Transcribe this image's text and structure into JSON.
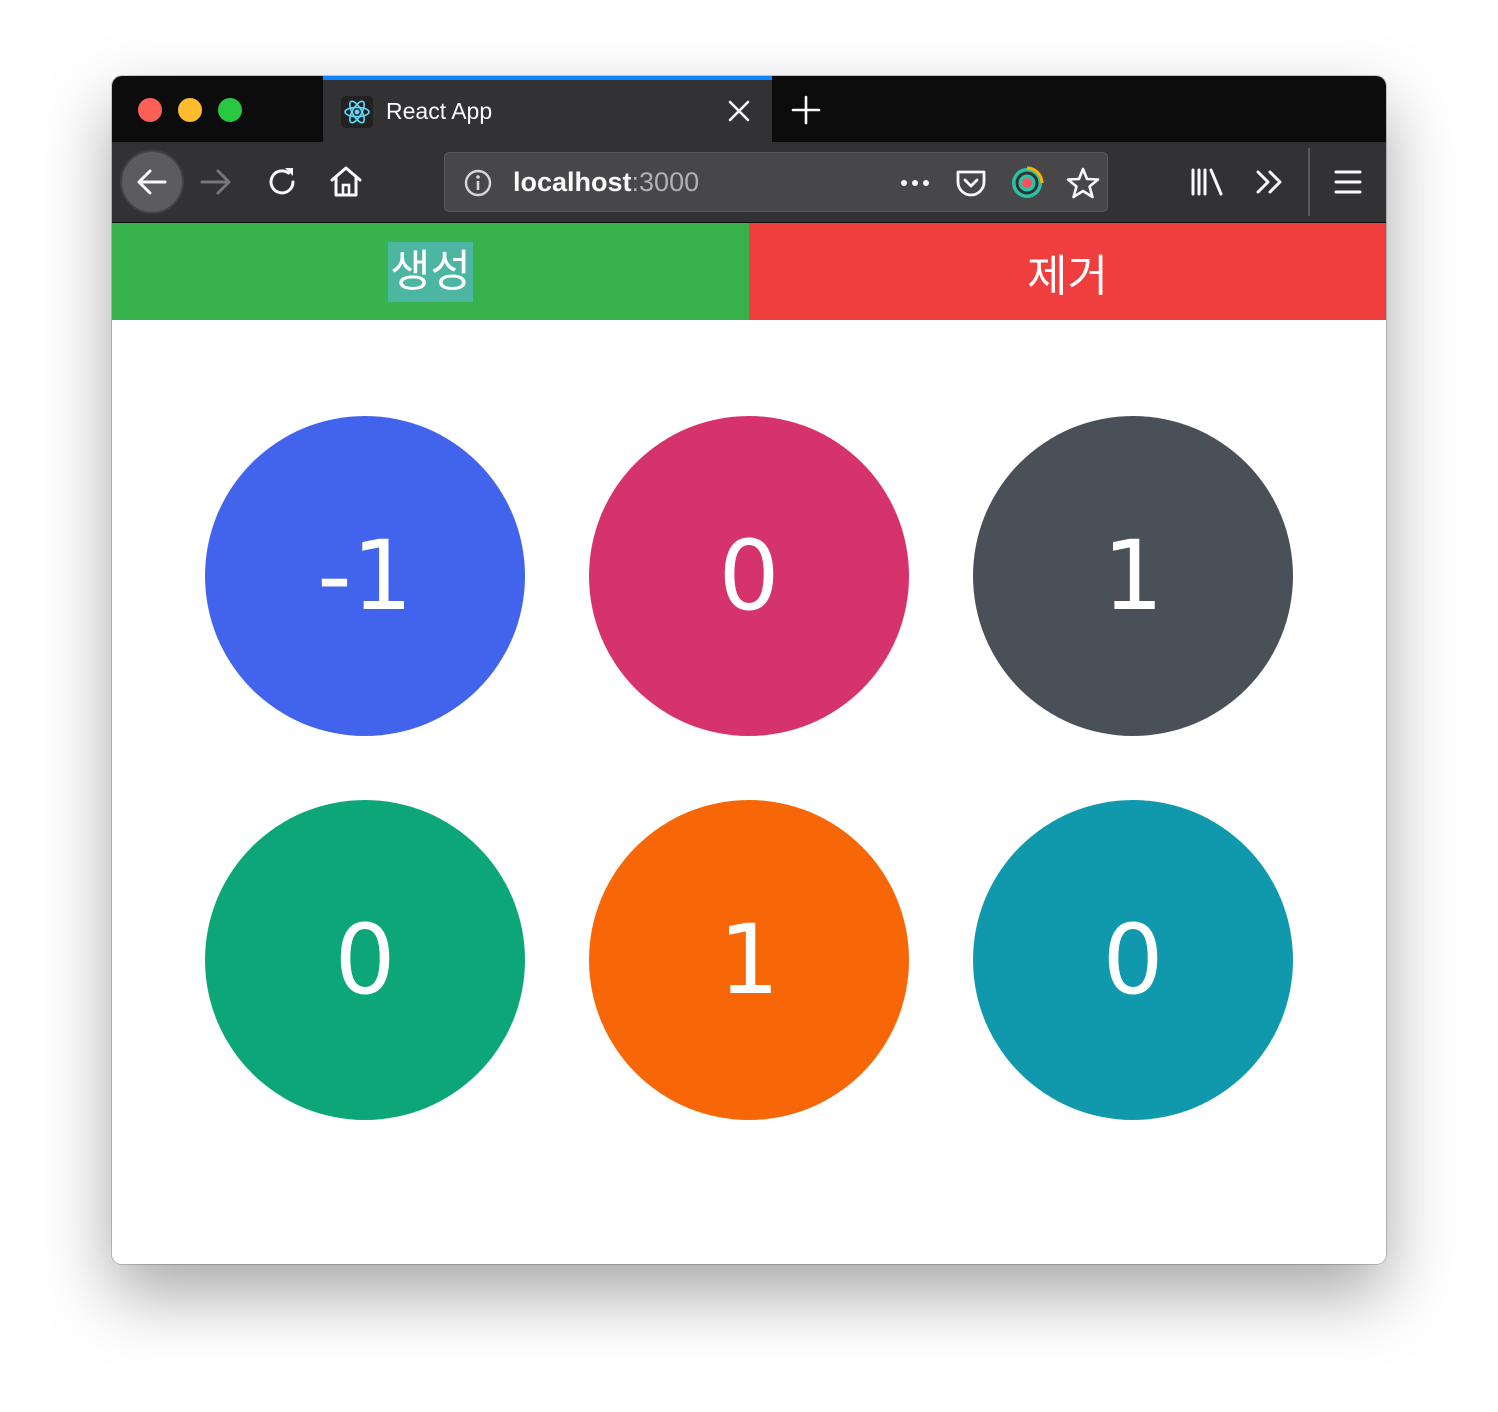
{
  "browser": {
    "tab": {
      "title": "React App",
      "favicon": "react-icon"
    },
    "url": {
      "host": "localhost",
      "port": ":3000"
    },
    "toolbar_icons": [
      "back-icon",
      "forward-icon",
      "reload-icon",
      "home-icon",
      "info-icon",
      "more-icon",
      "pocket-icon",
      "extension-icon",
      "star-icon",
      "library-icon",
      "overflow-icon",
      "menu-icon"
    ]
  },
  "controls": {
    "create_label": "생성",
    "remove_label": "제거",
    "create_color": "#38b24d",
    "remove_color": "#f03e3e"
  },
  "circles": [
    {
      "value": "-1",
      "color": "#4263eb"
    },
    {
      "value": "0",
      "color": "#d6336c"
    },
    {
      "value": "1",
      "color": "#495057"
    },
    {
      "value": "0",
      "color": "#0ca678"
    },
    {
      "value": "1",
      "color": "#f76707"
    },
    {
      "value": "0",
      "color": "#1098ad"
    }
  ]
}
